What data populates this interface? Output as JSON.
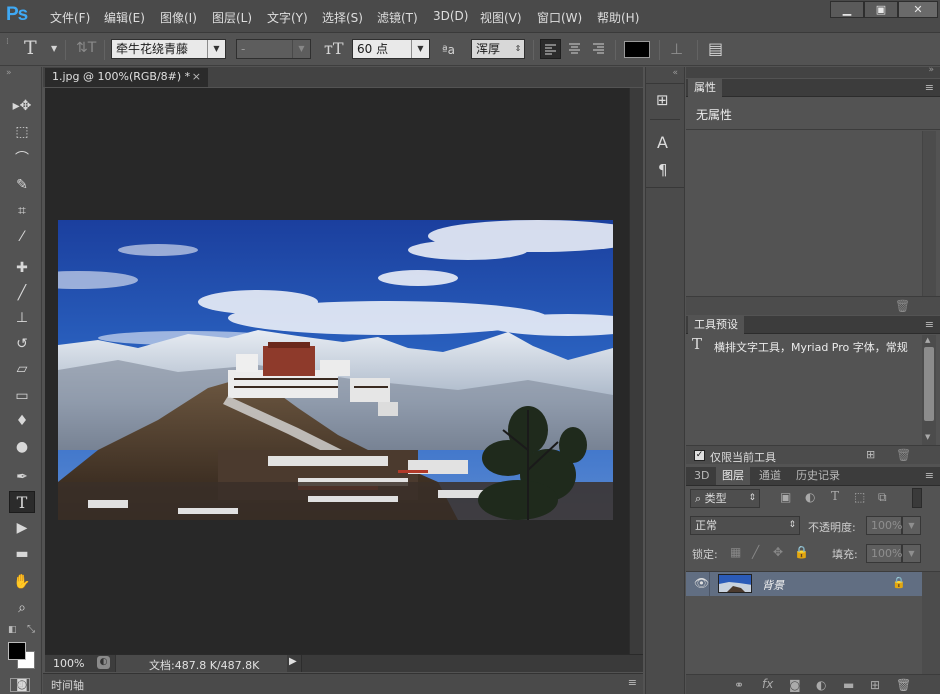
{
  "app": {
    "logo": "Ps"
  },
  "menu": [
    "文件(F)",
    "编辑(E)",
    "图像(I)",
    "图层(L)",
    "文字(Y)",
    "选择(S)",
    "滤镜(T)",
    "3D(D)",
    "视图(V)",
    "窗口(W)",
    "帮助(H)"
  ],
  "window_buttons": {
    "minimize": "▁",
    "restore": "▣",
    "close": "✕"
  },
  "options": {
    "tool_glyph": "T",
    "font_family": "牵牛花绕青藤",
    "font_style": "-",
    "font_size": "60 点",
    "aa_label": "ªa",
    "antialias": "浑厚",
    "text_color": "#000000"
  },
  "document": {
    "tab_title": "1.jpg @ 100%(RGB/8#) *",
    "tab_close": "×",
    "zoom": "100%",
    "doc_info": "文档:487.8 K/487.8K"
  },
  "timeline": {
    "label": "时间轴"
  },
  "properties_panel": {
    "tab": "属性",
    "content": "无属性"
  },
  "tool_presets_panel": {
    "tab": "工具预设",
    "item": "横排文字工具，Myriad Pro 字体，常规",
    "current_tool_only": "仅限当前工具"
  },
  "layers_panel": {
    "tabs": [
      "3D",
      "图层",
      "通道",
      "历史记录"
    ],
    "filter_label": "类型",
    "blend_mode": "正常",
    "opacity_label": "不透明度:",
    "opacity_value": "100%",
    "lock_label": "锁定:",
    "fill_label": "填充:",
    "fill_value": "100%",
    "layers": [
      {
        "name": "背景",
        "visible": true,
        "locked": true
      }
    ]
  },
  "colors": {
    "accent_blue": "#3fa9f5",
    "foreground": "#000000",
    "background": "#ffffff"
  }
}
